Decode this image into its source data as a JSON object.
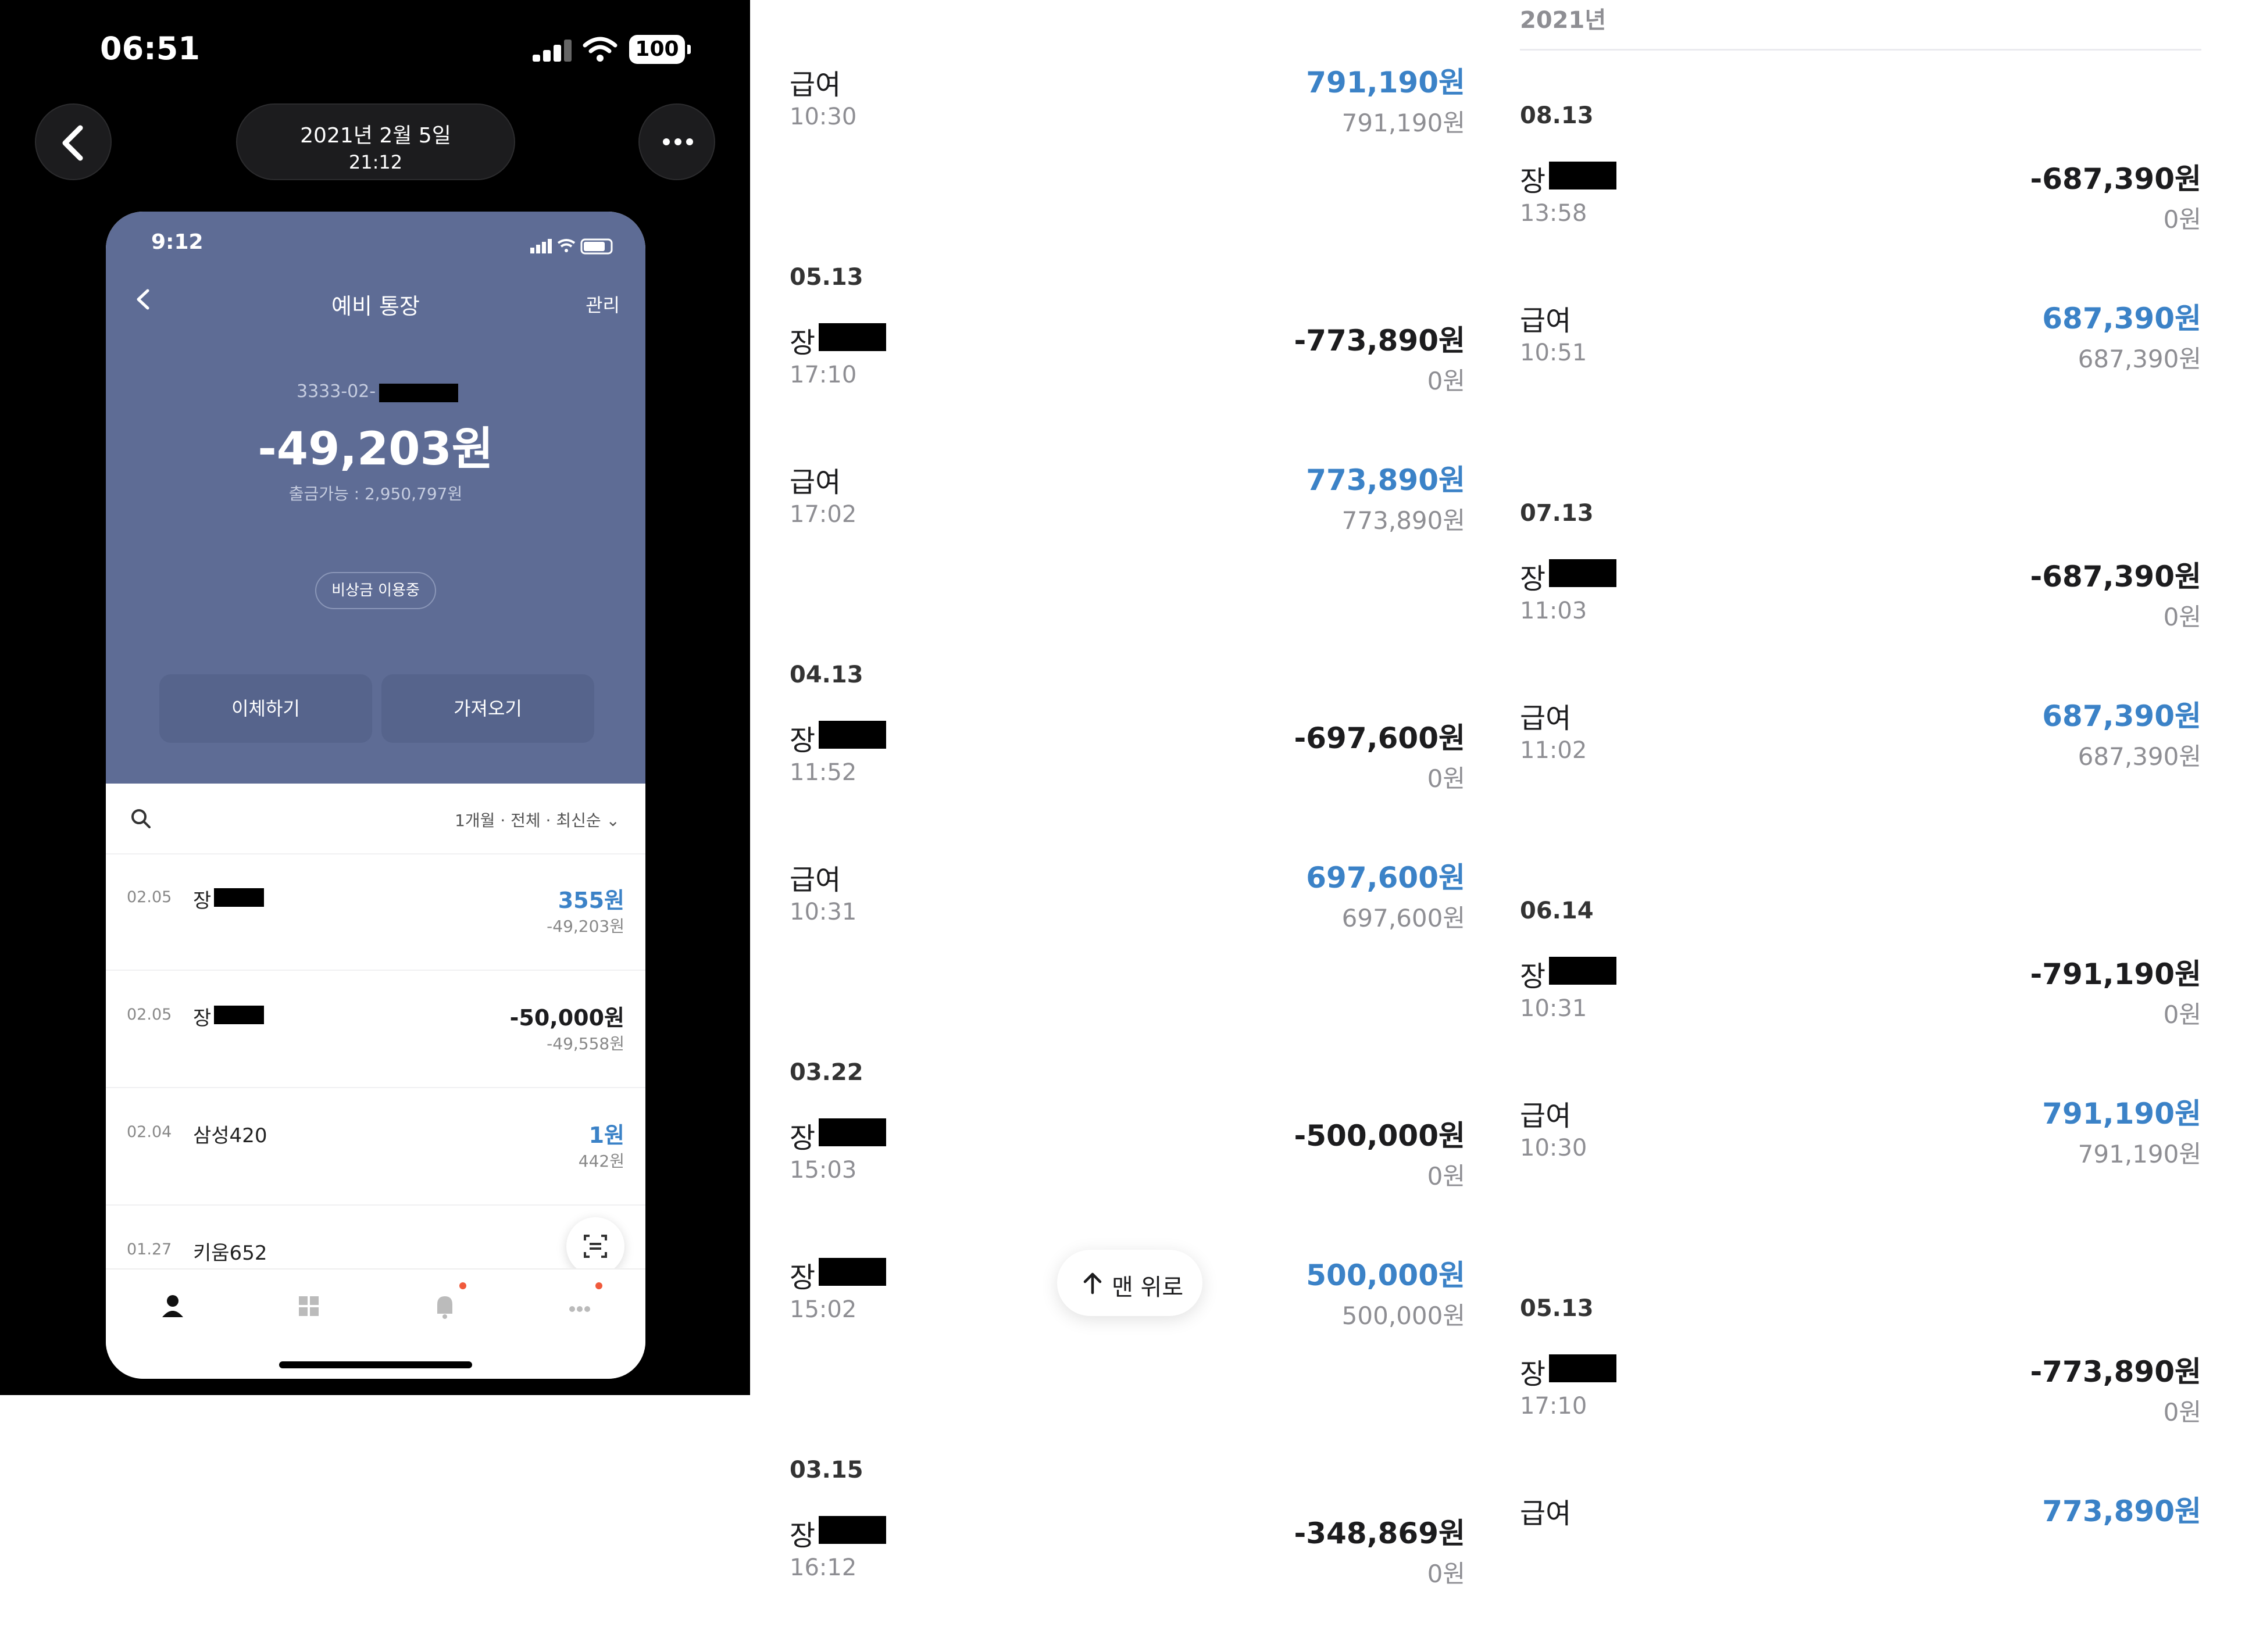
{
  "viewer": {
    "status_time": "06:51",
    "battery": "100",
    "date": "2021년 2월 5일",
    "time": "21:12"
  },
  "phone": {
    "status_time": "9:12",
    "title": "예비 통장",
    "manage": "관리",
    "account_prefix": "3333-02-",
    "balance": "-49,203원",
    "available": "출금가능 : 2,950,797원",
    "badge": "비상금 이용중",
    "btn_transfer": "이체하기",
    "btn_import": "가져오기",
    "filter": "1개월 · 전체 · 최신순",
    "rows": [
      {
        "date": "02.05",
        "name": "장",
        "masked": true,
        "amount": "355원",
        "balance": "-49,203원",
        "positive": true
      },
      {
        "date": "02.05",
        "name": "장",
        "masked": true,
        "amount": "-50,000원",
        "balance": "-49,558원",
        "positive": false
      },
      {
        "date": "02.04",
        "name": "삼성420",
        "masked": false,
        "amount": "1원",
        "balance": "442원",
        "positive": true
      },
      {
        "date": "01.27",
        "name": "키움652",
        "masked": false,
        "amount": "",
        "balance": "",
        "positive": true
      }
    ]
  },
  "col1": {
    "sections": [
      {
        "date": "",
        "items": [
          {
            "name": "급여",
            "masked": false,
            "time": "10:30",
            "amount": "791,190원",
            "after": "791,190원",
            "positive": true
          }
        ]
      },
      {
        "date": "05.13",
        "items": [
          {
            "name": "장",
            "masked": true,
            "time": "17:10",
            "amount": "-773,890원",
            "after": "0원",
            "positive": false
          },
          {
            "name": "급여",
            "masked": false,
            "time": "17:02",
            "amount": "773,890원",
            "after": "773,890원",
            "positive": true
          }
        ]
      },
      {
        "date": "04.13",
        "items": [
          {
            "name": "장",
            "masked": true,
            "time": "11:52",
            "amount": "-697,600원",
            "after": "0원",
            "positive": false
          },
          {
            "name": "급여",
            "masked": false,
            "time": "10:31",
            "amount": "697,600원",
            "after": "697,600원",
            "positive": true
          }
        ]
      },
      {
        "date": "03.22",
        "items": [
          {
            "name": "장",
            "masked": true,
            "time": "15:03",
            "amount": "-500,000원",
            "after": "0원",
            "positive": false
          },
          {
            "name": "장",
            "masked": true,
            "time": "15:02",
            "amount": "500,000원",
            "after": "500,000원",
            "positive": true
          }
        ]
      },
      {
        "date": "03.15",
        "items": [
          {
            "name": "장",
            "masked": true,
            "time": "16:12",
            "amount": "-348,869원",
            "after": "0원",
            "positive": false
          }
        ]
      }
    ]
  },
  "col2": {
    "year": "2021년",
    "sections": [
      {
        "date": "08.13",
        "items": [
          {
            "name": "장",
            "masked": true,
            "time": "13:58",
            "amount": "-687,390원",
            "after": "0원",
            "positive": false
          },
          {
            "name": "급여",
            "masked": false,
            "time": "10:51",
            "amount": "687,390원",
            "after": "687,390원",
            "positive": true
          }
        ]
      },
      {
        "date": "07.13",
        "items": [
          {
            "name": "장",
            "masked": true,
            "time": "11:03",
            "amount": "-687,390원",
            "after": "0원",
            "positive": false
          },
          {
            "name": "급여",
            "masked": false,
            "time": "11:02",
            "amount": "687,390원",
            "after": "687,390원",
            "positive": true
          }
        ]
      },
      {
        "date": "06.14",
        "items": [
          {
            "name": "장",
            "masked": true,
            "time": "10:31",
            "amount": "-791,190원",
            "after": "0원",
            "positive": false
          },
          {
            "name": "급여",
            "masked": false,
            "time": "10:30",
            "amount": "791,190원",
            "after": "791,190원",
            "positive": true
          }
        ]
      },
      {
        "date": "05.13",
        "items": [
          {
            "name": "장",
            "masked": true,
            "time": "17:10",
            "amount": "-773,890원",
            "after": "0원",
            "positive": false
          },
          {
            "name": "급여",
            "masked": false,
            "time": "",
            "amount": "773,890원",
            "after": "",
            "positive": true
          }
        ]
      }
    ]
  },
  "scroll_top_label": "맨 위로"
}
